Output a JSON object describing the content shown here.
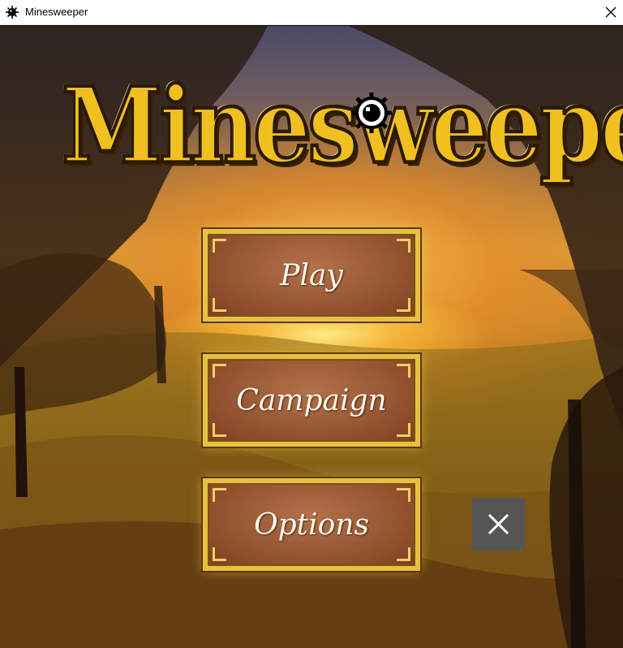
{
  "window": {
    "title": "Minesweeper",
    "app_icon": "mine-icon",
    "close_icon": "close-icon"
  },
  "logo": {
    "text": "Minesweeper",
    "color": "#f0c020",
    "icon": "mine-icon"
  },
  "menu": {
    "play_label": "Play",
    "campaign_label": "Campaign",
    "options_label": "Options",
    "exit_icon": "close-icon"
  },
  "colors": {
    "button_fill": "#8f4f2d",
    "button_border": "#e8c040",
    "exit_button_bg": "#555555"
  }
}
